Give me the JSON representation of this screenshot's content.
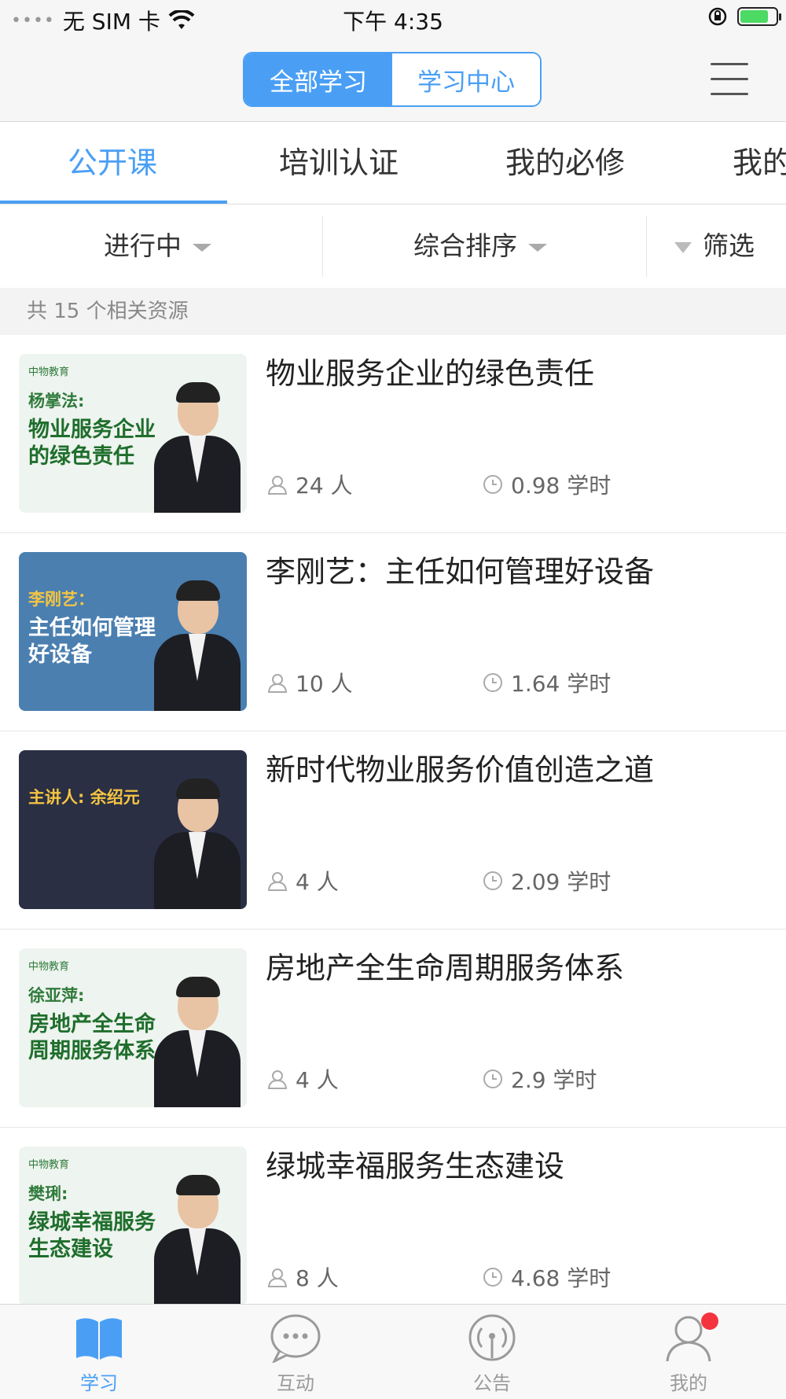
{
  "status_bar": {
    "carrier": "无 SIM 卡",
    "time": "下午 4:35",
    "battery_level": 0.8
  },
  "header": {
    "segments": [
      "全部学习",
      "学习中心"
    ],
    "active_segment": 0,
    "menu_icon": "hamburger-icon"
  },
  "tabs": {
    "items": [
      "公开课",
      "培训认证",
      "我的必修",
      "我的"
    ],
    "active": 0
  },
  "filters": {
    "status": "进行中",
    "sort": "综合排序",
    "filter": "筛选"
  },
  "result_count": "共 15 个相关资源",
  "courses": [
    {
      "title": "物业服务企业的绿色责任",
      "learners": "24 人",
      "hours": "0.98 学时",
      "thumb_label": "杨掌法:",
      "thumb_title": "物业服务企业的绿色责任",
      "thumb_logo": "中物教育",
      "thumb_bg": "#eef4ef"
    },
    {
      "title": "李刚艺：主任如何管理好设备",
      "learners": "10 人",
      "hours": "1.64 学时",
      "thumb_label": "李刚艺：",
      "thumb_title": "主任如何管理好设备",
      "thumb_logo": "",
      "thumb_bg": "#4a7fb0"
    },
    {
      "title": "新时代物业服务价值创造之道",
      "learners": "4 人",
      "hours": "2.09 学时",
      "thumb_label": "主讲人: 余绍元",
      "thumb_title": "",
      "thumb_logo": "",
      "thumb_bg": "#2a2f44"
    },
    {
      "title": "房地产全生命周期服务体系",
      "learners": "4 人",
      "hours": "2.9 学时",
      "thumb_label": "徐亚萍:",
      "thumb_title": "房地产全生命周期服务体系",
      "thumb_logo": "中物教育",
      "thumb_bg": "#eef4ef"
    },
    {
      "title": "绿城幸福服务生态建设",
      "learners": "8 人",
      "hours": "4.68 学时",
      "thumb_label": "樊琍:",
      "thumb_title": "绿城幸福服务生态建设",
      "thumb_logo": "中物教育",
      "thumb_bg": "#eef4ef"
    }
  ],
  "bottom_nav": {
    "items": [
      {
        "label": "学习",
        "icon": "book-icon"
      },
      {
        "label": "互动",
        "icon": "chat-bubble-icon"
      },
      {
        "label": "公告",
        "icon": "broadcast-icon"
      },
      {
        "label": "我的",
        "icon": "user-icon"
      }
    ],
    "active": 0
  },
  "colors": {
    "accent": "#4a9ff5",
    "text": "#333333",
    "muted": "#888888",
    "badge": "#f5333f"
  }
}
